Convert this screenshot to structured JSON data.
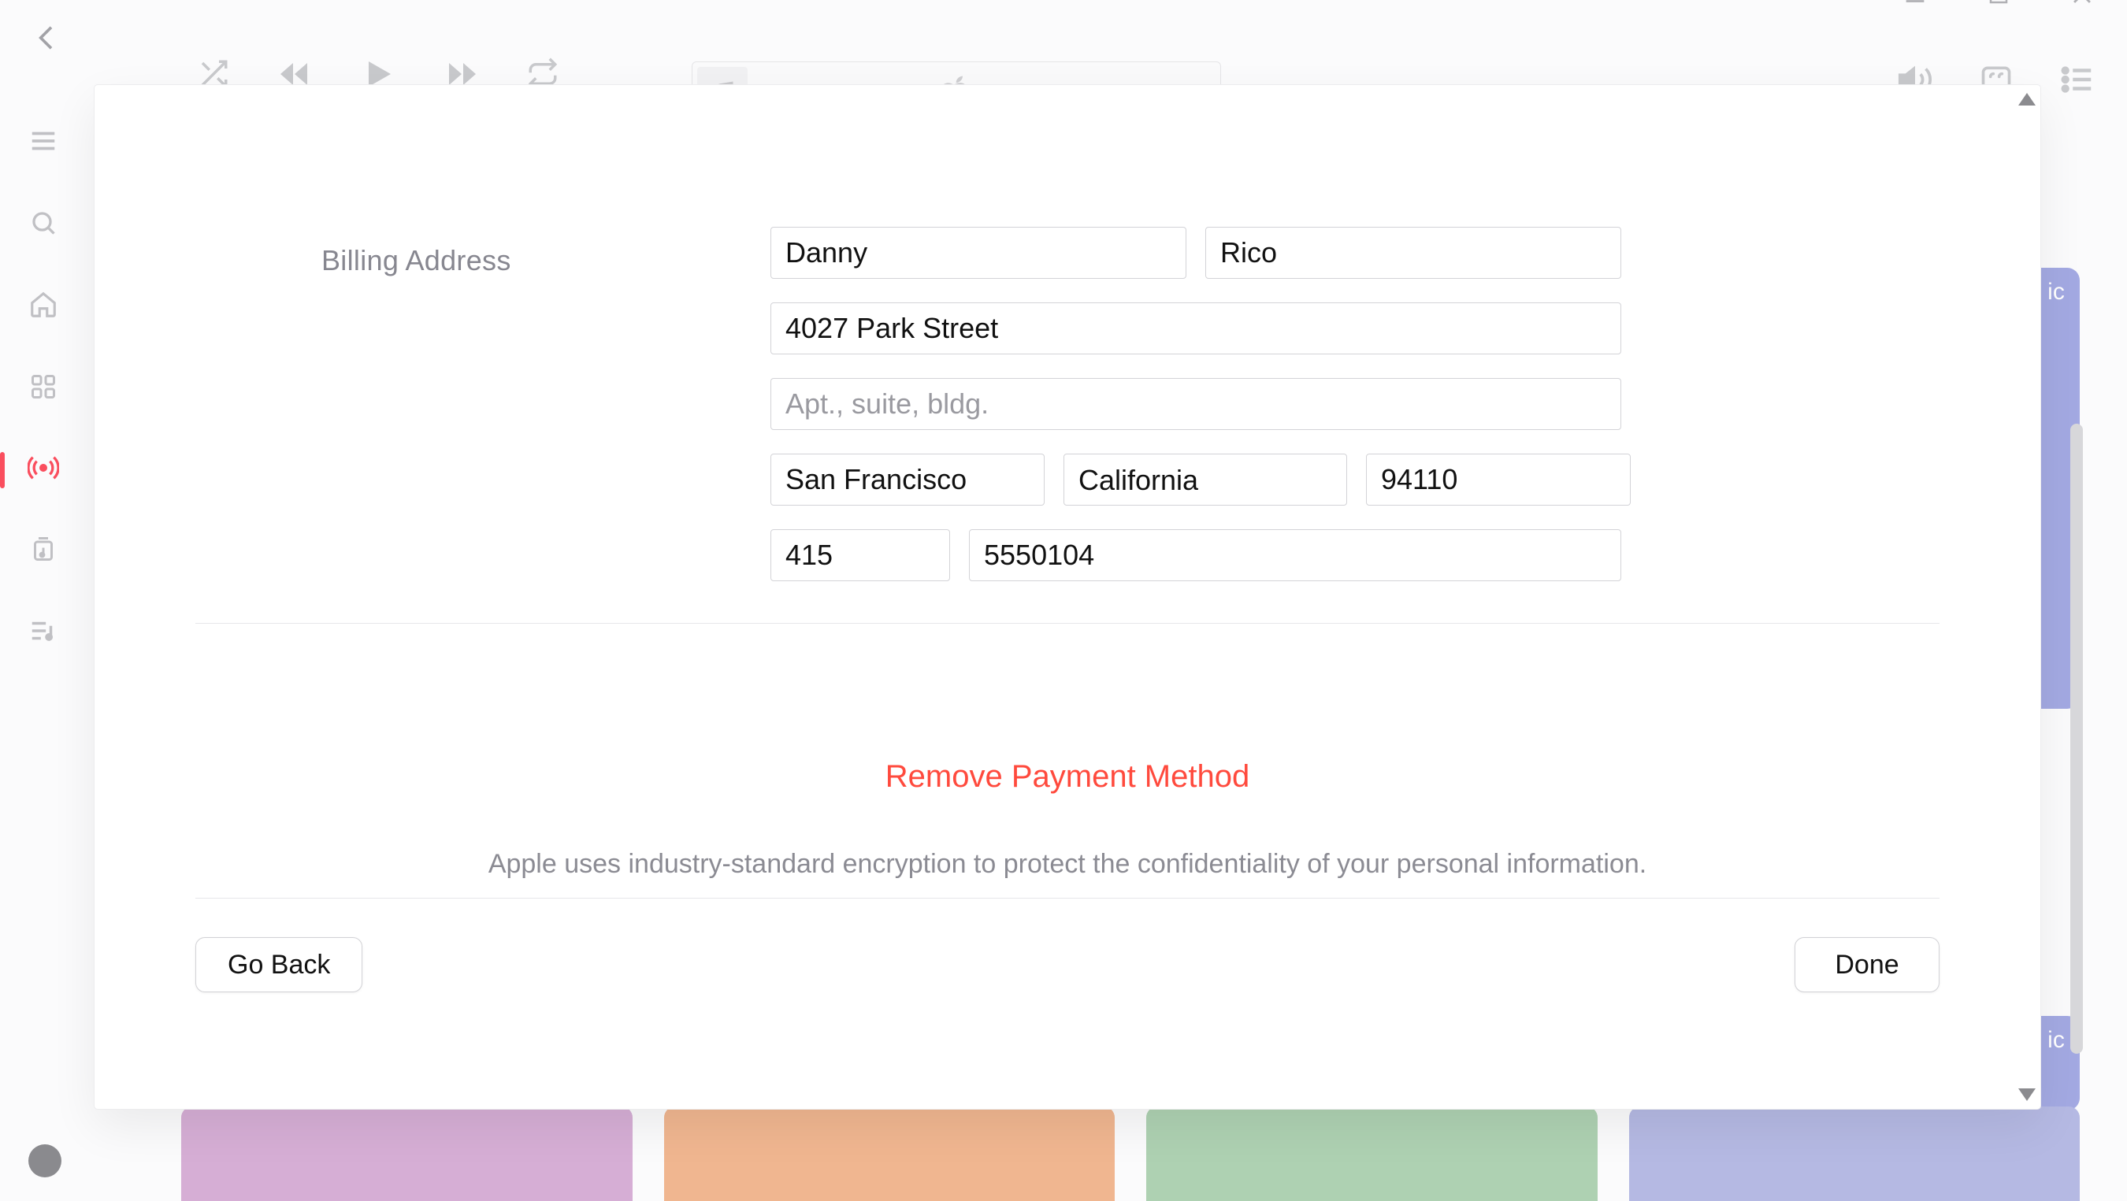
{
  "section_label": "Billing Address",
  "fields": {
    "first_name": "Danny",
    "last_name": "Rico",
    "street": "4027 Park Street",
    "apt_placeholder": "Apt., suite, bldg.",
    "apt_value": "",
    "city": "San Francisco",
    "state": "California",
    "zip": "94110",
    "area_code": "415",
    "phone": "5550104"
  },
  "links": {
    "remove_payment": "Remove Payment Method"
  },
  "disclosure": "Apple uses industry-standard encryption to protect the confidentiality of your personal information.",
  "buttons": {
    "go_back": "Go Back",
    "done": "Done"
  },
  "background": {
    "side_badge_text": "ic"
  }
}
